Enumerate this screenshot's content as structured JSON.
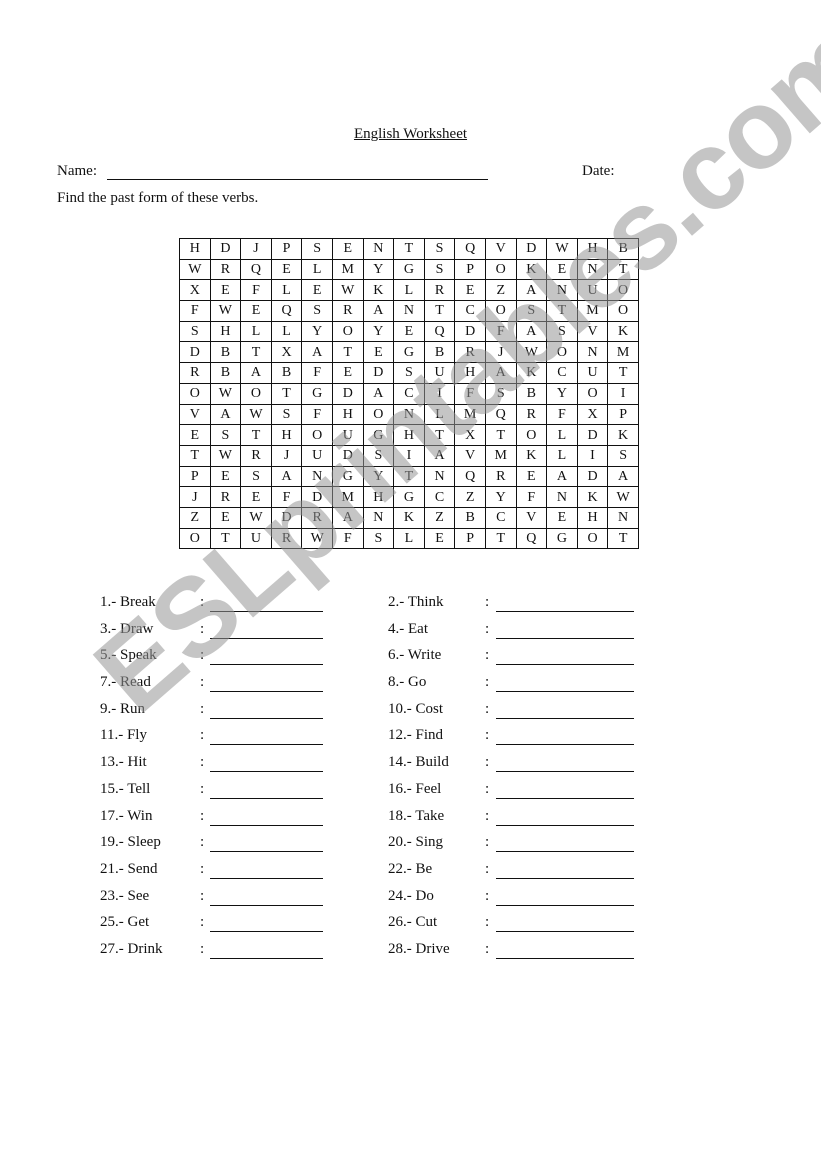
{
  "worksheet": {
    "title": "English Worksheet",
    "name_label": "Name:",
    "date_label": "Date:",
    "instructions": "Find the past form of these verbs."
  },
  "grid": [
    [
      "H",
      "D",
      "J",
      "P",
      "S",
      "E",
      "N",
      "T",
      "S",
      "Q",
      "V",
      "D",
      "W",
      "H",
      "B"
    ],
    [
      "W",
      "R",
      "Q",
      "E",
      "L",
      "M",
      "Y",
      "G",
      "S",
      "P",
      "O",
      "K",
      "E",
      "N",
      "T"
    ],
    [
      "X",
      "E",
      "F",
      "L",
      "E",
      "W",
      "K",
      "L",
      "R",
      "E",
      "Z",
      "A",
      "N",
      "U",
      "O"
    ],
    [
      "F",
      "W",
      "E",
      "Q",
      "S",
      "R",
      "A",
      "N",
      "T",
      "C",
      "O",
      "S",
      "T",
      "M",
      "O"
    ],
    [
      "S",
      "H",
      "L",
      "L",
      "Y",
      "O",
      "Y",
      "E",
      "Q",
      "D",
      "F",
      "A",
      "S",
      "V",
      "K"
    ],
    [
      "D",
      "B",
      "T",
      "X",
      "A",
      "T",
      "E",
      "G",
      "B",
      "R",
      "J",
      "W",
      "O",
      "N",
      "M"
    ],
    [
      "R",
      "B",
      "A",
      "B",
      "F",
      "E",
      "D",
      "S",
      "U",
      "H",
      "A",
      "K",
      "C",
      "U",
      "T"
    ],
    [
      "O",
      "W",
      "O",
      "T",
      "G",
      "D",
      "A",
      "C",
      "I",
      "F",
      "S",
      "B",
      "Y",
      "O",
      "I"
    ],
    [
      "V",
      "A",
      "W",
      "S",
      "F",
      "H",
      "O",
      "N",
      "L",
      "M",
      "Q",
      "R",
      "F",
      "X",
      "P"
    ],
    [
      "E",
      "S",
      "T",
      "H",
      "O",
      "U",
      "G",
      "H",
      "T",
      "X",
      "T",
      "O",
      "L",
      "D",
      "K"
    ],
    [
      "T",
      "W",
      "R",
      "J",
      "U",
      "D",
      "S",
      "I",
      "A",
      "V",
      "M",
      "K",
      "L",
      "I",
      "S"
    ],
    [
      "P",
      "E",
      "S",
      "A",
      "N",
      "G",
      "Y",
      "T",
      "N",
      "Q",
      "R",
      "E",
      "A",
      "D",
      "A"
    ],
    [
      "J",
      "R",
      "E",
      "F",
      "D",
      "M",
      "H",
      "G",
      "C",
      "Z",
      "Y",
      "F",
      "N",
      "K",
      "W"
    ],
    [
      "Z",
      "E",
      "W",
      "D",
      "R",
      "A",
      "N",
      "K",
      "Z",
      "B",
      "C",
      "V",
      "E",
      "H",
      "N"
    ],
    [
      "O",
      "T",
      "U",
      "R",
      "W",
      "F",
      "S",
      "L",
      "E",
      "P",
      "T",
      "Q",
      "G",
      "O",
      "T"
    ]
  ],
  "colon": ":",
  "verbs_left": [
    "1.- Break",
    "3.- Draw",
    "5.- Speak",
    "7.- Read",
    "9.- Run",
    "11.- Fly",
    "13.- Hit",
    "15.- Tell",
    "17.- Win",
    "19.- Sleep",
    "21.- Send",
    "23.- See",
    "25.- Get",
    "27.- Drink"
  ],
  "verbs_right": [
    "2.- Think",
    "4.- Eat",
    "6.- Write",
    "8.- Go",
    "10.- Cost",
    "12.- Find",
    "14.- Build",
    "16.- Feel",
    "18.- Take",
    "20.- Sing",
    "22.- Be",
    "24.- Do",
    "26.- Cut",
    "28.- Drive"
  ],
  "watermark": "ESLprintables.com"
}
